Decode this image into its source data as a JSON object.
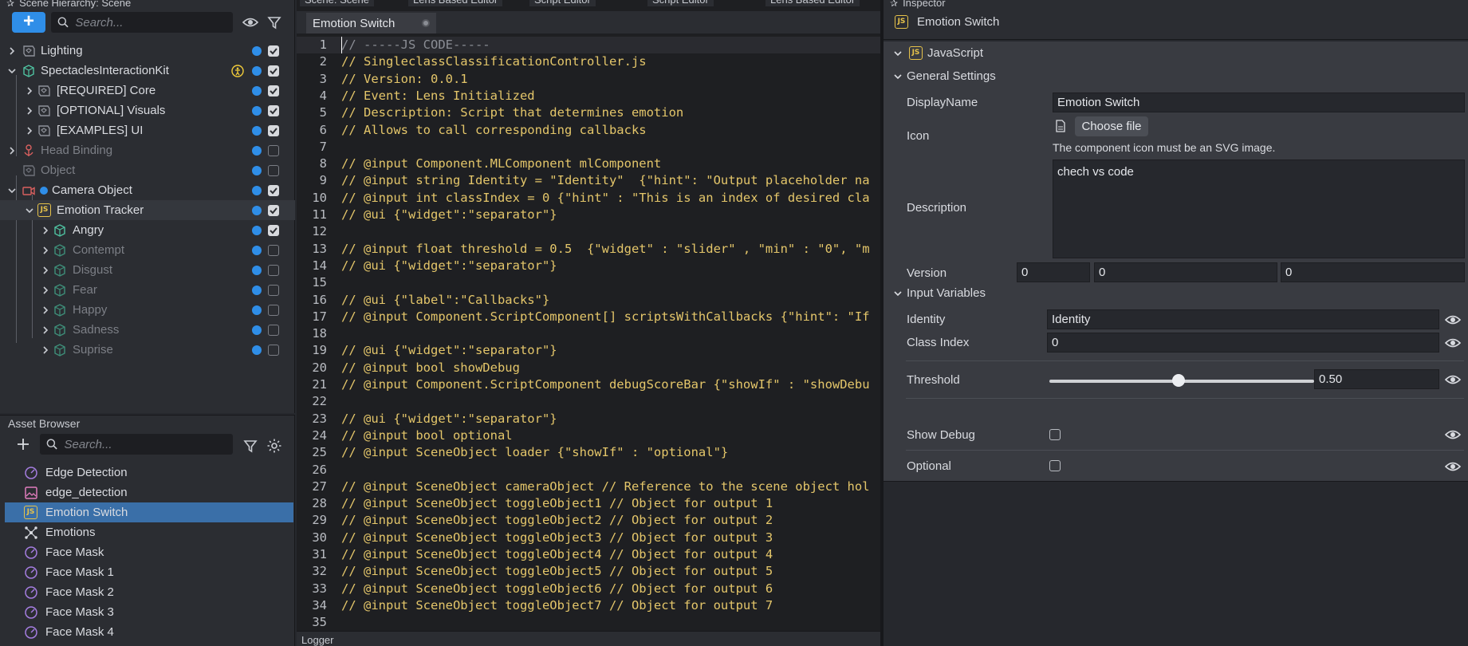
{
  "scene_hierarchy": {
    "title": "Scene Hierarchy: Scene",
    "search_placeholder": "Search...",
    "items": [
      {
        "label": "Lighting"
      },
      {
        "label": "SpectaclesInteractionKit"
      },
      {
        "label": "[REQUIRED] Core"
      },
      {
        "label": "[OPTIONAL] Visuals"
      },
      {
        "label": "[EXAMPLES] UI"
      },
      {
        "label": "Head Binding"
      },
      {
        "label": "Object"
      },
      {
        "label": "Camera Object"
      },
      {
        "label": "Emotion Tracker"
      },
      {
        "label": "Angry"
      },
      {
        "label": "Contempt"
      },
      {
        "label": "Disgust"
      },
      {
        "label": "Fear"
      },
      {
        "label": "Happy"
      },
      {
        "label": "Sadness"
      },
      {
        "label": "Suprise"
      }
    ]
  },
  "asset_browser": {
    "title": "Asset Browser",
    "search_placeholder": "Search...",
    "items": [
      {
        "label": "Edge Detection"
      },
      {
        "label": "edge_detection"
      },
      {
        "label": "Emotion Switch"
      },
      {
        "label": "Emotions"
      },
      {
        "label": "Face Mask"
      },
      {
        "label": "Face Mask 1"
      },
      {
        "label": "Face Mask 2"
      },
      {
        "label": "Face Mask 3"
      },
      {
        "label": "Face Mask 4"
      }
    ]
  },
  "editor": {
    "top_tabs": [
      "Scene: Scene",
      "Lens Based Editor",
      "Script Editor",
      "Script Editor",
      "Lens Based Editor"
    ],
    "file_tab": "Emotion Switch",
    "logger_title": "Logger",
    "lines": [
      {
        "n": "1",
        "t": "// -----JS CODE-----"
      },
      {
        "n": "2",
        "t": "// SingleclassClassificationController.js"
      },
      {
        "n": "3",
        "t": "// Version: 0.0.1"
      },
      {
        "n": "4",
        "t": "// Event: Lens Initialized"
      },
      {
        "n": "5",
        "t": "// Description: Script that determines emotion"
      },
      {
        "n": "6",
        "t": "// Allows to call corresponding callbacks"
      },
      {
        "n": "7",
        "t": ""
      },
      {
        "n": "8",
        "t": "// @input Component.MLComponent mlComponent"
      },
      {
        "n": "9",
        "t": "// @input string Identity = \"Identity\"  {\"hint\": \"Output placeholder na"
      },
      {
        "n": "10",
        "t": "// @input int classIndex = 0 {\"hint\" : \"This is an index of desired cla"
      },
      {
        "n": "11",
        "t": "// @ui {\"widget\":\"separator\"}"
      },
      {
        "n": "12",
        "t": ""
      },
      {
        "n": "13",
        "t": "// @input float threshold = 0.5  {\"widget\" : \"slider\" , \"min\" : \"0\", \"m"
      },
      {
        "n": "14",
        "t": "// @ui {\"widget\":\"separator\"}"
      },
      {
        "n": "15",
        "t": ""
      },
      {
        "n": "16",
        "t": "// @ui {\"label\":\"Callbacks\"}"
      },
      {
        "n": "17",
        "t": "// @input Component.ScriptComponent[] scriptsWithCallbacks {\"hint\": \"If"
      },
      {
        "n": "18",
        "t": ""
      },
      {
        "n": "19",
        "t": "// @ui {\"widget\":\"separator\"}"
      },
      {
        "n": "20",
        "t": "// @input bool showDebug"
      },
      {
        "n": "21",
        "t": "// @input Component.ScriptComponent debugScoreBar {\"showIf\" : \"showDebu"
      },
      {
        "n": "22",
        "t": ""
      },
      {
        "n": "23",
        "t": "// @ui {\"widget\":\"separator\"}"
      },
      {
        "n": "24",
        "t": "// @input bool optional"
      },
      {
        "n": "25",
        "t": "// @input SceneObject loader {\"showIf\" : \"optional\"}"
      },
      {
        "n": "26",
        "t": ""
      },
      {
        "n": "27",
        "t": "// @input SceneObject cameraObject // Reference to the scene object hol"
      },
      {
        "n": "28",
        "t": "// @input SceneObject toggleObject1 // Object for output 1"
      },
      {
        "n": "29",
        "t": "// @input SceneObject toggleObject2 // Object for output 2"
      },
      {
        "n": "30",
        "t": "// @input SceneObject toggleObject3 // Object for output 3"
      },
      {
        "n": "31",
        "t": "// @input SceneObject toggleObject4 // Object for output 4"
      },
      {
        "n": "32",
        "t": "// @input SceneObject toggleObject5 // Object for output 5"
      },
      {
        "n": "33",
        "t": "// @input SceneObject toggleObject6 // Object for output 6"
      },
      {
        "n": "34",
        "t": "// @input SceneObject toggleObject7 // Object for output 7"
      },
      {
        "n": "35",
        "t": ""
      }
    ]
  },
  "inspector": {
    "title": "Inspector",
    "object_name": "Emotion Switch",
    "component": "JavaScript",
    "general_settings": "General Settings",
    "display_name_label": "DisplayName",
    "display_name_value": "Emotion Switch",
    "icon_label": "Icon",
    "choose_file": "Choose file",
    "icon_hint": "The component icon must be an SVG image.",
    "description_label": "Description",
    "description_value": "chech vs code",
    "version_label": "Version",
    "version_values": [
      "0",
      "0",
      "0"
    ],
    "input_variables": "Input Variables",
    "identity_label": "Identity",
    "identity_value": "Identity",
    "class_index_label": "Class Index",
    "class_index_value": "0",
    "threshold_label": "Threshold",
    "threshold_value": "0.50",
    "show_debug_label": "Show Debug",
    "optional_label": "Optional"
  },
  "colors": {
    "accent": "#2f8ee8",
    "js_yellow": "#e6c24a",
    "code_text": "#e4c66a",
    "selection": "#3a6fa8"
  }
}
